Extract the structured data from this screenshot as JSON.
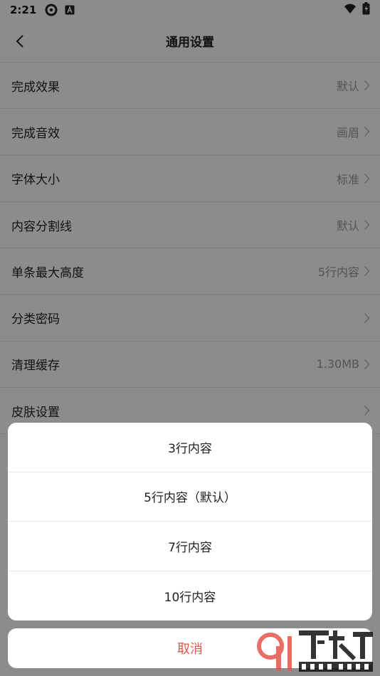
{
  "status_bar": {
    "time": "2:21",
    "icons_left": [
      "settings-icon",
      "app-a-icon"
    ],
    "icons_right": [
      "wifi-icon",
      "battery-icon"
    ]
  },
  "header": {
    "title": "通用设置",
    "back_icon": "chevron-left-icon"
  },
  "settings": [
    {
      "label": "完成效果",
      "value": "默认"
    },
    {
      "label": "完成音效",
      "value": "画眉"
    },
    {
      "label": "字体大小",
      "value": "标准"
    },
    {
      "label": "内容分割线",
      "value": "默认"
    },
    {
      "label": "单条最大高度",
      "value": "5行内容"
    },
    {
      "label": "分类密码",
      "value": ""
    },
    {
      "label": "清理缓存",
      "value": "1.30MB"
    },
    {
      "label": "皮肤设置",
      "value": ""
    }
  ],
  "action_sheet": {
    "options": [
      "3行内容",
      "5行内容（默认）",
      "7行内容",
      "10行内容"
    ],
    "cancel": "取消"
  },
  "colors": {
    "cancel_text": "#e8534a",
    "value_text": "#999999",
    "overlay": "rgba(0,0,0,0.45)"
  }
}
